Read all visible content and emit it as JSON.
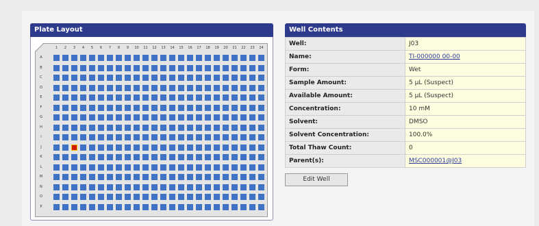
{
  "plate": {
    "title": "Plate Layout",
    "columns": [
      "1",
      "2",
      "3",
      "4",
      "5",
      "6",
      "7",
      "8",
      "9",
      "10",
      "11",
      "12",
      "13",
      "14",
      "15",
      "16",
      "17",
      "18",
      "19",
      "20",
      "21",
      "22",
      "23",
      "24"
    ],
    "rows": [
      "A",
      "B",
      "C",
      "D",
      "E",
      "F",
      "G",
      "H",
      "I",
      "J",
      "K",
      "L",
      "M",
      "N",
      "O",
      "P"
    ],
    "selected_well": {
      "row": "J",
      "column": "3"
    },
    "colors": {
      "well": "#3f72c4",
      "selected": "#d01a00",
      "selected_border": "#f2c400"
    }
  },
  "well_contents": {
    "title": "Well Contents",
    "fields": [
      {
        "label": "Well:",
        "value": "J03",
        "link": false
      },
      {
        "label": "Name:",
        "value": "TI-000000 00-00",
        "link": true
      },
      {
        "label": "Form:",
        "value": "Wet",
        "link": false
      },
      {
        "label": "Sample Amount:",
        "value": "5 µL (Suspect)",
        "link": false
      },
      {
        "label": "Available Amount:",
        "value": "5 µL (Suspect)",
        "link": false
      },
      {
        "label": "Concentration:",
        "value": "10 mM",
        "link": false
      },
      {
        "label": "Solvent:",
        "value": "DMSO",
        "link": false
      },
      {
        "label": "Solvent Concentration:",
        "value": "100.0%",
        "link": false
      },
      {
        "label": "Total Thaw Count:",
        "value": "0",
        "link": false
      },
      {
        "label": "Parent(s):",
        "value": "MSC000001@J03",
        "link": true
      }
    ],
    "edit_button": "Edit Well"
  }
}
